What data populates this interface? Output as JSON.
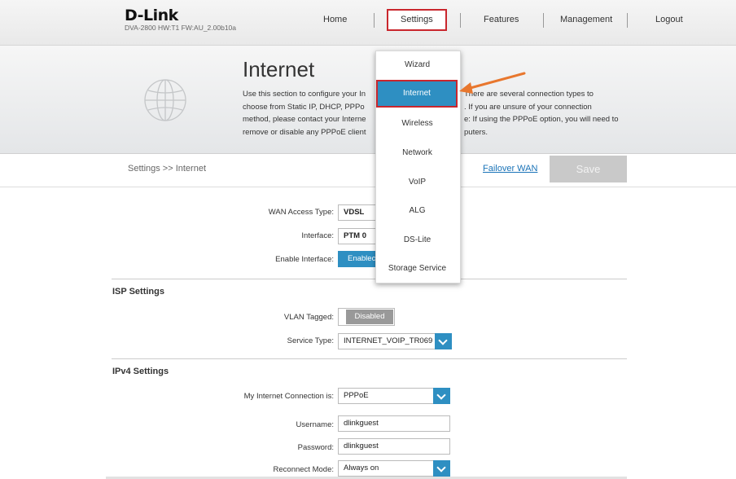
{
  "brand": {
    "logo": "D-Link",
    "model_info": "DVA-2800   HW:T1   FW:AU_2.00b10a"
  },
  "nav": {
    "home": "Home",
    "settings": "Settings",
    "features": "Features",
    "management": "Management",
    "logout": "Logout"
  },
  "banner": {
    "title": "Internet",
    "desc_lines": [
      "Use this section to configure your In",
      "choose from Static IP, DHCP, PPPo",
      "method, please contact your Interne",
      "remove or disable any PPPoE client"
    ],
    "desc_right_lines": [
      "There are several connection types to",
      ". If you are unsure of your connection",
      "e: If using the PPPoE option, you will need to",
      "puters."
    ]
  },
  "breadcrumb": "Settings >> Internet",
  "failover_link": "Failover WAN",
  "save_label": "Save",
  "settings_menu": {
    "items": [
      "Wizard",
      "Internet",
      "Wireless",
      "Network",
      "VoIP",
      "ALG",
      "DS-Lite",
      "Storage Service"
    ],
    "selected": "Internet"
  },
  "wan": {
    "access_type_label": "WAN Access Type:",
    "access_type_value": "VDSL",
    "interface_label": "Interface:",
    "interface_value": "PTM 0",
    "enable_label": "Enable Interface:",
    "enable_value": "Enablec"
  },
  "isp": {
    "title": "ISP Settings",
    "vlan_label": "VLAN Tagged:",
    "vlan_value": "Disabled",
    "service_label": "Service Type:",
    "service_value": "INTERNET_VOIP_TR069"
  },
  "ipv4": {
    "title": "IPv4 Settings",
    "connection_label": "My Internet Connection is:",
    "connection_value": "PPPoE",
    "username_label": "Username:",
    "username_value": "dlinkguest",
    "password_label": "Password:",
    "password_value": "dlinkguest",
    "reconnect_label": "Reconnect Mode:",
    "reconnect_value": "Always on"
  },
  "colors": {
    "accent": "#2e8fc2",
    "highlight": "#c9262d",
    "arrow": "#e8772e"
  },
  "icons": {
    "banner": "globe-icon",
    "annotation": "arrow-icon"
  }
}
